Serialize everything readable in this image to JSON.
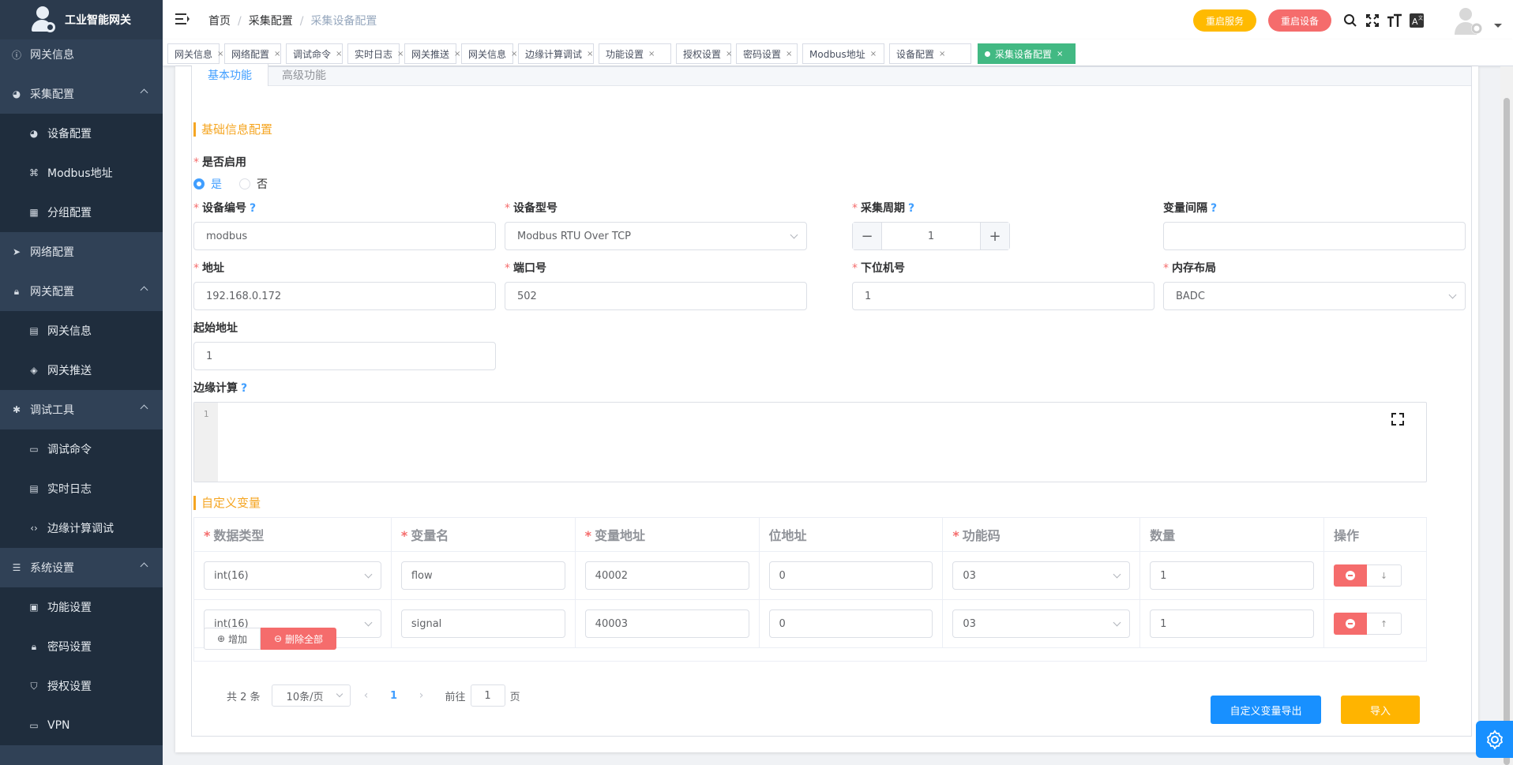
{
  "app": {
    "title": "工业智能网关"
  },
  "sidebar": {
    "items": [
      {
        "label": "网关信息",
        "icon": "info-icon",
        "sub": false
      },
      {
        "label": "采集配置",
        "icon": "dashboard-icon",
        "sub": false,
        "arrow": true
      },
      {
        "label": "设备配置",
        "icon": "dashboard-icon",
        "sub": true
      },
      {
        "label": "Modbus地址",
        "icon": "grid-icon",
        "sub": true
      },
      {
        "label": "分组配置",
        "icon": "table-icon",
        "sub": true
      },
      {
        "label": "网络配置",
        "icon": "send-icon",
        "sub": false
      },
      {
        "label": "网关配置",
        "icon": "lock-icon",
        "sub": false,
        "arrow": true
      },
      {
        "label": "网关信息",
        "icon": "document-icon",
        "sub": true
      },
      {
        "label": "网关推送",
        "icon": "push-icon",
        "sub": true
      },
      {
        "label": "调试工具",
        "icon": "bug-icon",
        "sub": false,
        "arrow": true
      },
      {
        "label": "调试命令",
        "icon": "terminal-icon",
        "sub": true
      },
      {
        "label": "实时日志",
        "icon": "log-icon",
        "sub": true
      },
      {
        "label": "边缘计算调试",
        "icon": "code-icon",
        "sub": true
      },
      {
        "label": "系统设置",
        "icon": "list-icon",
        "sub": false,
        "arrow": true
      },
      {
        "label": "功能设置",
        "icon": "file-icon",
        "sub": true
      },
      {
        "label": "密码设置",
        "icon": "lock-icon",
        "sub": true
      },
      {
        "label": "授权设置",
        "icon": "shield-icon",
        "sub": true
      },
      {
        "label": "VPN",
        "icon": "monitor-icon",
        "sub": true
      }
    ]
  },
  "header": {
    "breadcrumb": [
      "首页",
      "采集配置",
      "采集设备配置"
    ],
    "restart_service": "重启服务",
    "restart_device": "重启设备"
  },
  "tags": [
    "网关信息",
    "网络配置",
    "调试命令",
    "实时日志",
    "网关推送",
    "网关信息",
    "边缘计算调试",
    "功能设置",
    "授权设置",
    "密码设置",
    "Modbus地址",
    "设备配置",
    "采集设备配置"
  ],
  "tabs": {
    "basic": "基本功能",
    "advanced": "高级功能"
  },
  "form": {
    "section_basic": "基础信息配置",
    "enable_label": "是否启用",
    "enable_yes": "是",
    "enable_no": "否",
    "device_id_label": "设备编号",
    "device_id_value": "modbus",
    "device_model_label": "设备型号",
    "device_model_value": "Modbus RTU Over TCP",
    "period_label": "采集周期",
    "period_value": "1",
    "var_interval_label": "变量间隔",
    "var_interval_value": "",
    "address_label": "地址",
    "address_value": "192.168.0.172",
    "port_label": "端口号",
    "port_value": "502",
    "slave_label": "下位机号",
    "slave_value": "1",
    "memory_label": "内存布局",
    "memory_value": "BADC",
    "start_addr_label": "起始地址",
    "start_addr_value": "1",
    "edge_label": "边缘计算",
    "edge_line": "1"
  },
  "vars": {
    "section": "自定义变量",
    "headers": [
      "数据类型",
      "变量名",
      "变量地址",
      "位地址",
      "功能码",
      "数量",
      "操作"
    ],
    "rows": [
      {
        "type": "int(16)",
        "name": "flow",
        "addr": "40002",
        "bit": "0",
        "fc": "03",
        "qty": "1",
        "move": "↓"
      },
      {
        "type": "int(16)",
        "name": "signal",
        "addr": "40003",
        "bit": "0",
        "fc": "03",
        "qty": "1",
        "move": "↑"
      }
    ],
    "add": "增加",
    "delete_all": "删除全部"
  },
  "pager": {
    "total": "共 2 条",
    "size": "10条/页",
    "current": "1",
    "goto": "前往",
    "goto_value": "1",
    "page_unit": "页"
  },
  "actions": {
    "export": "自定义变量导出",
    "import": "导入"
  }
}
